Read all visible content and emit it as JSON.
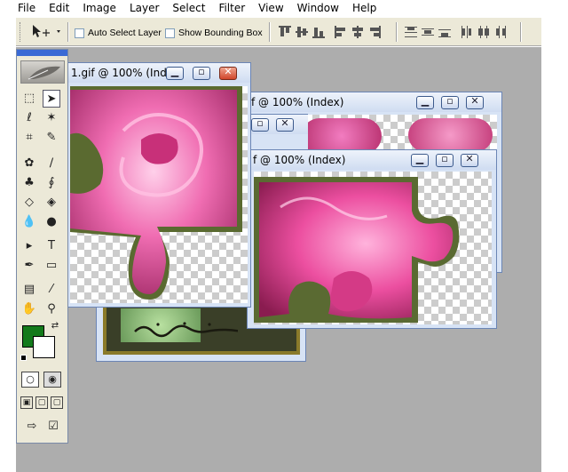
{
  "menu": [
    "File",
    "Edit",
    "Image",
    "Layer",
    "Select",
    "Filter",
    "View",
    "Window",
    "Help"
  ],
  "options_bar": {
    "auto_select_label": "Auto Select Layer",
    "show_bounding_label": "Show Bounding Box",
    "auto_select_checked": false,
    "show_bounding_checked": false
  },
  "toolbox": {
    "foreground_color": "#137a1b",
    "background_color": "#ffffff"
  },
  "windows": [
    {
      "title": "1.gif @ 100% (Ind...",
      "active": true
    },
    {
      "title": "f @ 100% (Index)",
      "active": false
    },
    {
      "title": "f @ 100% (Index)",
      "active": false
    },
    {
      "title": "",
      "active": false
    }
  ],
  "accent_color": "#3a6ad5"
}
